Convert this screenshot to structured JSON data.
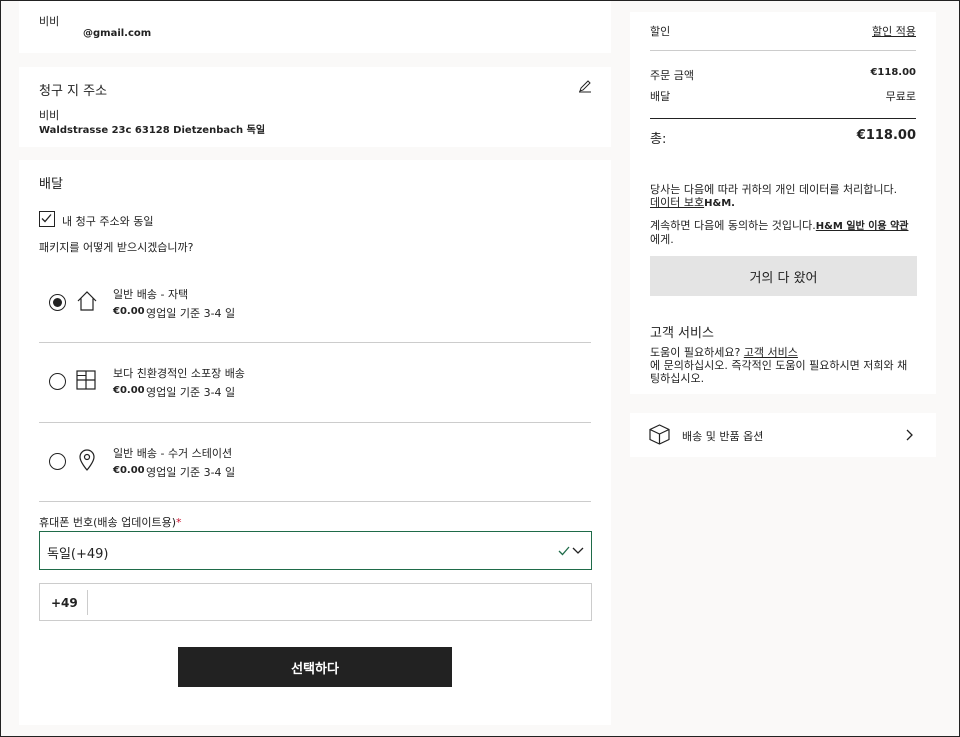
{
  "contact": {
    "name": "비비",
    "email": "@gmail.com"
  },
  "billing": {
    "title": "청구 지 주소",
    "name": "비비",
    "address": "Waldstrasse 23c 63128 Dietzenbach 독일"
  },
  "delivery": {
    "title": "배달",
    "same_as_billing_label": "내 청구 주소와 동일",
    "question": "패키지를 어떻게 받으시겠습니까?",
    "options": [
      {
        "title": "일반 배송 - 자택",
        "price": "€0.00",
        "eta": "영업일 기준 3-4 일",
        "selected": true,
        "icon": "home-icon"
      },
      {
        "title": "보다 친환경적인 소포장 배송",
        "price": "€0.00",
        "eta": "영업일 기준 3-4 일",
        "selected": false,
        "icon": "parcel-locker-icon"
      },
      {
        "title": "일반 배송 - 수거 스테이션",
        "price": "€0.00",
        "eta": "영업일 기준 3-4 일",
        "selected": false,
        "icon": "location-pin-icon"
      }
    ],
    "phone_label": "휴대폰 번호(배송 업데이트용)",
    "required_mark": "*",
    "country_selected": "독일(+49)",
    "phone_prefix": "+49",
    "phone_value": "",
    "submit_label": "선택하다"
  },
  "summary": {
    "discount_label": "할인",
    "apply_discount_label": "할인 적용",
    "order_amount_label": "주문 금액",
    "order_amount_value": "€118.00",
    "shipping_label": "배달",
    "shipping_value": "무료로",
    "total_label": "총:",
    "total_value": "€118.00",
    "privacy_text": "당사는 다음에 따라 귀하의 개인 데이터를 처리합니다.",
    "privacy_link": "데이터 보호",
    "privacy_suffix": "H&M.",
    "terms_text": "계속하면 다음에 동의하는 것입니다.",
    "terms_link": "H&M 일반 이용 약관",
    "terms_suffix": "에게.",
    "continue_label": "거의 다 왔어",
    "cs_title": "고객 서비스",
    "cs_question": "도움이 필요하세요?",
    "cs_link": "고객 서비스",
    "cs_line2": "에 문의하십시오. 즉각적인 도움이 필요하시면 저희와 채",
    "cs_line3": "팅하십시오."
  },
  "returns": {
    "label": "배송 및 반품 옵션"
  },
  "colors": {
    "accent_green": "#1f6b49",
    "required_red": "#c8102e",
    "dark": "#222222"
  }
}
